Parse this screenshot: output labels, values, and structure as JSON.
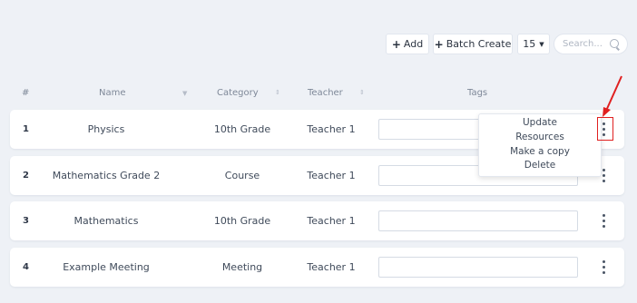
{
  "toolbar": {
    "add_label": "Add",
    "batch_create_label": "Batch Create",
    "page_size": "15",
    "search_placeholder": "Search..."
  },
  "table": {
    "columns": [
      "#",
      "Name",
      "Category",
      "Teacher",
      "Tags"
    ],
    "rows": [
      {
        "num": "1",
        "name": "Physics",
        "category": "10th Grade",
        "teacher": "Teacher 1"
      },
      {
        "num": "2",
        "name": "Mathematics Grade 2",
        "category": "Course",
        "teacher": "Teacher 1"
      },
      {
        "num": "3",
        "name": "Mathematics",
        "category": "10th Grade",
        "teacher": "Teacher 1"
      },
      {
        "num": "4",
        "name": "Example Meeting",
        "category": "Meeting",
        "teacher": "Teacher 1"
      }
    ]
  },
  "context_menu": {
    "items": [
      "Update",
      "Resources",
      "Make a copy",
      "Delete"
    ]
  },
  "colors": {
    "background": "#eef1f6",
    "annotation": "#e02020"
  }
}
